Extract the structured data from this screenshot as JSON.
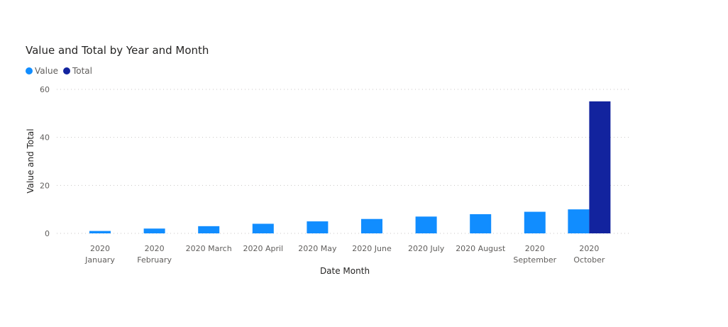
{
  "chart_data": {
    "type": "bar",
    "title": "Value and Total by Year and Month",
    "xlabel": "Date Month",
    "ylabel": "Value and Total",
    "ylim": [
      0,
      60
    ],
    "yticks": [
      0,
      20,
      40,
      60
    ],
    "grid": true,
    "legend_placement": "top-left",
    "categories": [
      [
        "2020",
        "January"
      ],
      [
        "2020",
        "February"
      ],
      [
        "2020 March"
      ],
      [
        "2020 April"
      ],
      [
        "2020 May"
      ],
      [
        "2020 June"
      ],
      [
        "2020 July"
      ],
      [
        "2020 August"
      ],
      [
        "2020",
        "September"
      ],
      [
        "2020",
        "October"
      ]
    ],
    "series": [
      {
        "name": "Value",
        "color": "#118DFF",
        "values": [
          1,
          2,
          3,
          4,
          5,
          6,
          7,
          8,
          9,
          10
        ]
      },
      {
        "name": "Total",
        "color": "#12239E",
        "values": [
          null,
          null,
          null,
          null,
          null,
          null,
          null,
          null,
          null,
          55
        ]
      }
    ]
  }
}
